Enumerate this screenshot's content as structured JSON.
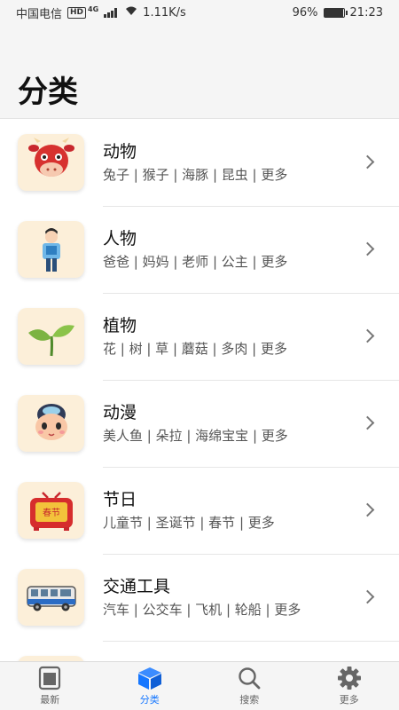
{
  "status": {
    "carrier": "中国电信",
    "hd": "HD",
    "net": "4G",
    "speed": "1.11K/s",
    "battery": "96%",
    "battery_level": 0.96,
    "time": "21:23"
  },
  "page": {
    "title": "分类"
  },
  "categories": [
    {
      "title": "动物",
      "subtitle": "兔子 | 猴子 | 海豚 | 昆虫 | 更多",
      "icon": "cow-face-icon"
    },
    {
      "title": "人物",
      "subtitle": "爸爸 | 妈妈 | 老师 | 公主 | 更多",
      "icon": "person-reading-icon"
    },
    {
      "title": "植物",
      "subtitle": "花 | 树 | 草 | 蘑菇 | 多肉 | 更多",
      "icon": "sprout-icon"
    },
    {
      "title": "动漫",
      "subtitle": "美人鱼 | 朵拉 | 海绵宝宝 | 更多",
      "icon": "anime-girl-icon"
    },
    {
      "title": "节日",
      "subtitle": "儿童节 | 圣诞节 | 春节 | 更多",
      "icon": "spring-festival-tv-icon",
      "badge": "春节"
    },
    {
      "title": "交通工具",
      "subtitle": "汽车 | 公交车 | 飞机 | 轮船 | 更多",
      "icon": "bus-icon"
    }
  ],
  "tabs": [
    {
      "label": "最新",
      "icon": "latest-icon",
      "active": false
    },
    {
      "label": "分类",
      "icon": "cube-icon",
      "active": true
    },
    {
      "label": "搜索",
      "icon": "search-icon",
      "active": false
    },
    {
      "label": "更多",
      "icon": "gear-icon",
      "active": false
    }
  ],
  "colors": {
    "accent": "#1677ff",
    "thumb_bg": "#fcefd9"
  }
}
